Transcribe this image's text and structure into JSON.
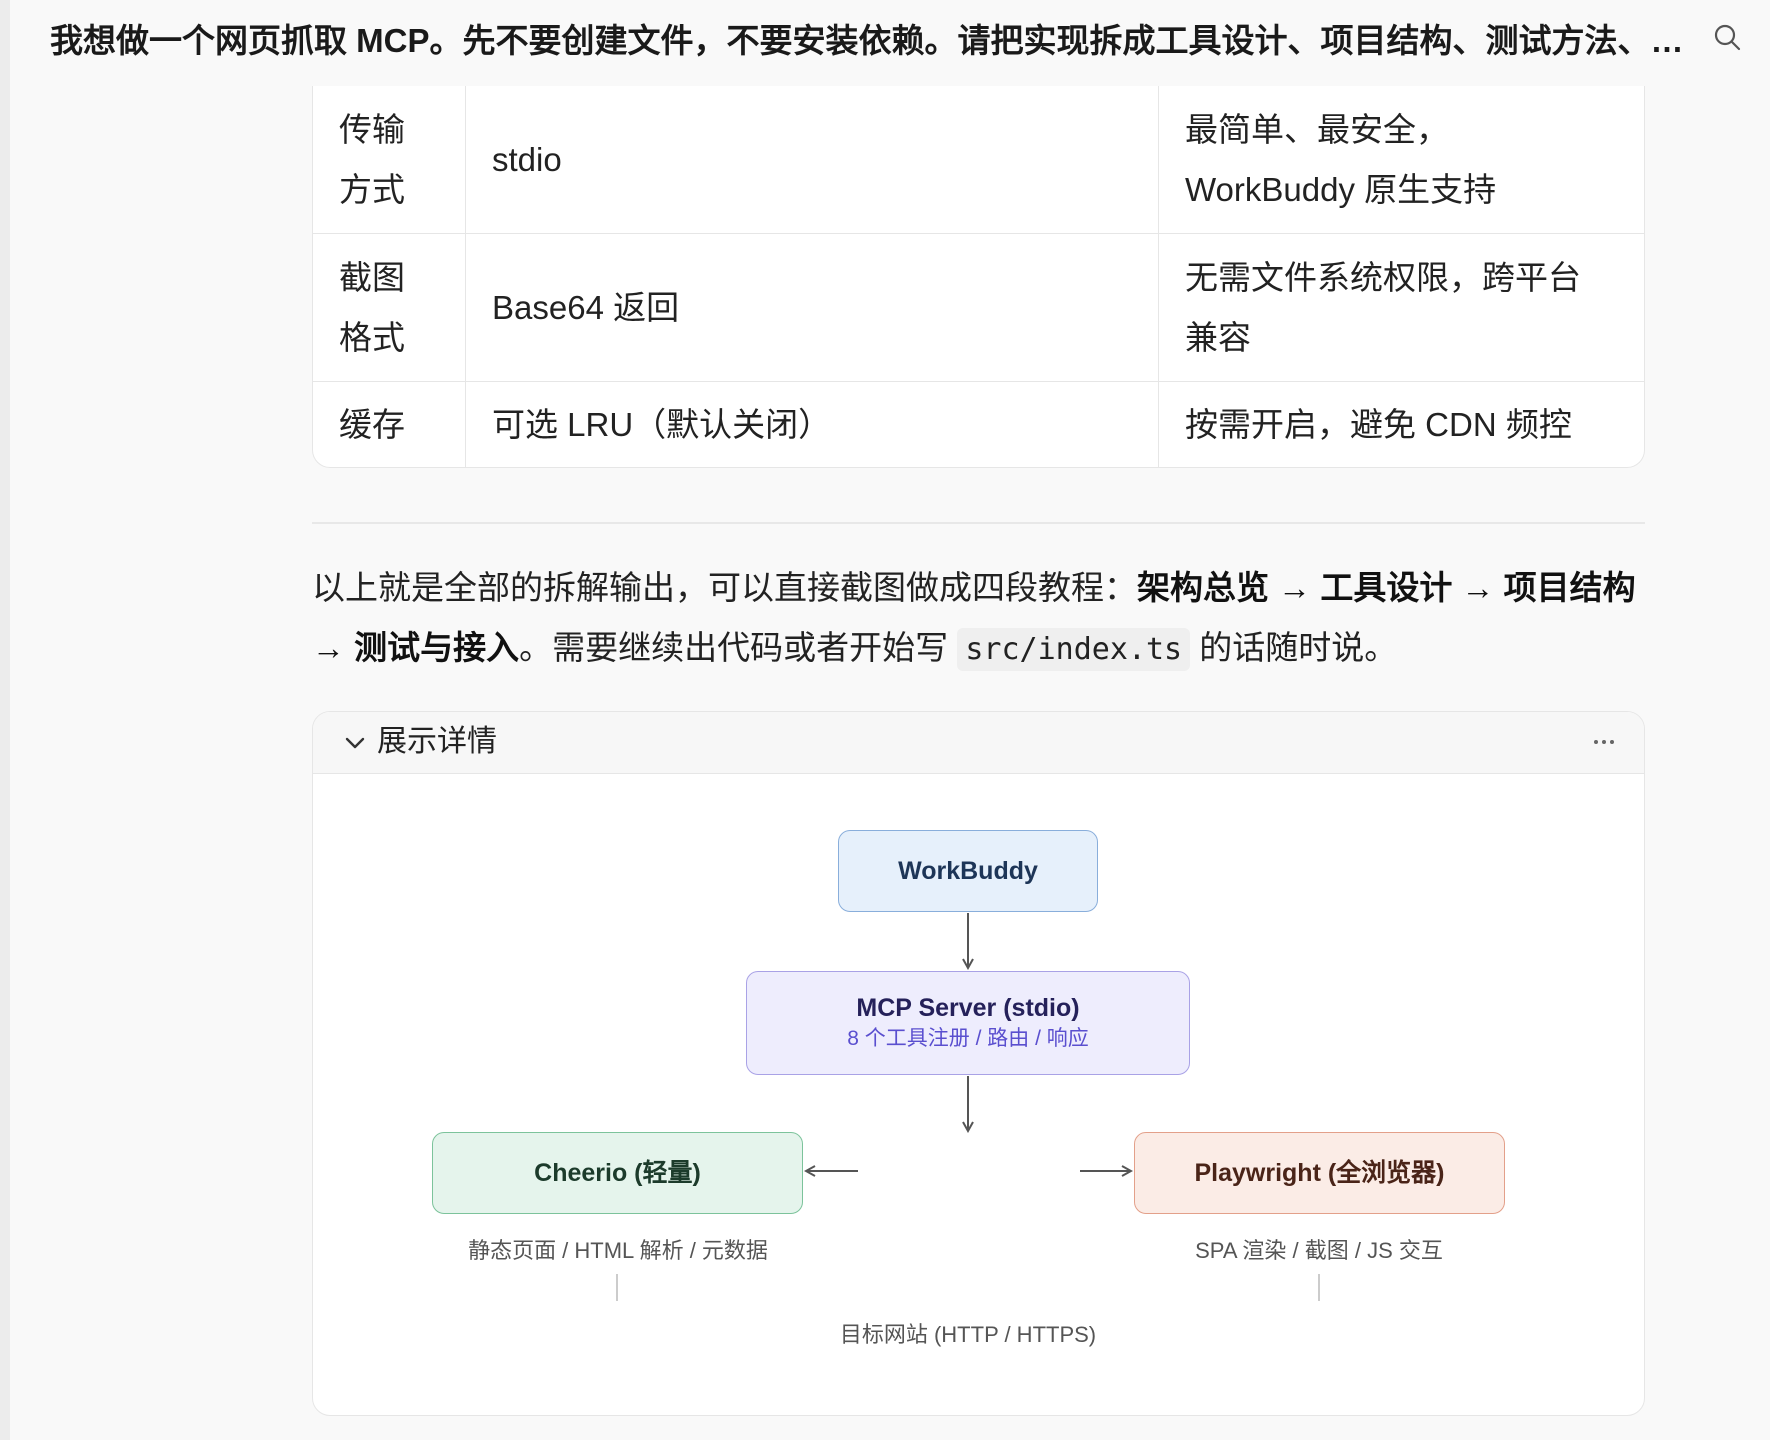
{
  "header": {
    "title": "我想做一个网页抓取 MCP。先不要创建文件，不要安装依赖。请把实现拆成工具设计、项目结构、测试方法、…",
    "search_icon": "search-icon"
  },
  "table": {
    "rows": [
      {
        "key": [
          "传输",
          "方式"
        ],
        "value": "stdio",
        "reason": [
          "最简单、最安全，",
          "WorkBuddy 原生支持"
        ]
      },
      {
        "key": [
          "截图",
          "格式"
        ],
        "value": "Base64 返回",
        "reason": [
          "无需文件系统权限，跨平台",
          "兼容"
        ]
      },
      {
        "key": [
          "缓存"
        ],
        "value": "可选 LRU（默认关闭）",
        "reason": [
          "按需开启，避免 CDN 频控"
        ]
      }
    ]
  },
  "summary": {
    "part1": "以上就是全部的拆解输出，可以直接截图做成四段教程：",
    "bold1": "架构总览 → 工具设计 → 项目结构 → 测试与接入",
    "part2": "。需要继续出代码或者开始写 ",
    "code": "src/index.ts",
    "part3": " 的话随时说。"
  },
  "details": {
    "label": "展示详情",
    "more_icon": "more-horizontal-icon",
    "diagram": {
      "workbuddy": "WorkBuddy",
      "mcp_title": "MCP Server (stdio)",
      "mcp_sub": "8 个工具注册 / 路由 / 响应",
      "cheerio": "Cheerio (轻量)",
      "cheerio_caption": "静态页面 / HTML 解析 / 元数据",
      "playwright": "Playwright (全浏览器)",
      "playwright_caption": "SPA 渲染 / 截图 / JS 交互",
      "target": "目标网站 (HTTP / HTTPS)"
    }
  }
}
